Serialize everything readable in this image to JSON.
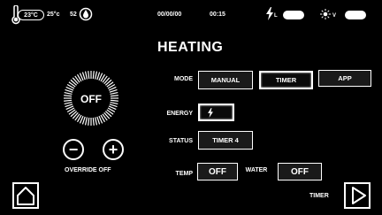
{
  "status_bar": {
    "inside_temp": "23°C",
    "outside_temp": "25°c",
    "humidity": "52",
    "date": "00/00/00",
    "time": "00:15",
    "power_label": "L",
    "sun_label": "V"
  },
  "page_title": "HEATING",
  "dial": {
    "state": "OFF",
    "override_label": "OVERRIDE OFF",
    "minus": "−",
    "plus": "+"
  },
  "mode": {
    "label": "MODE",
    "options": [
      "MANUAL",
      "TIMER",
      "APP"
    ],
    "selected": "TIMER"
  },
  "energy": {
    "label": "ENERGY",
    "icon": "lightning-icon"
  },
  "status": {
    "label": "STATUS",
    "value": "TIMER 4"
  },
  "temp": {
    "label": "TEMP",
    "value": "OFF"
  },
  "water": {
    "label": "WATER",
    "value": "OFF"
  },
  "footer": {
    "timer_label": "TIMER",
    "home_icon": "home-icon",
    "next_icon": "play-arrow-icon"
  }
}
